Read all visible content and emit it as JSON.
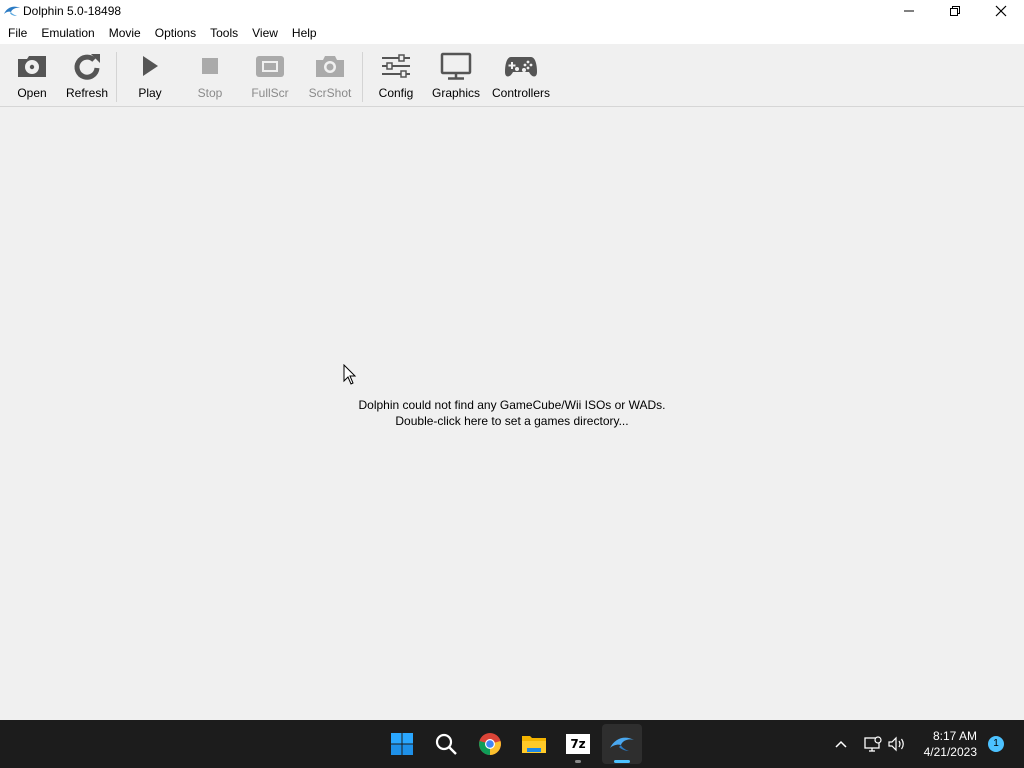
{
  "window": {
    "title": "Dolphin 5.0-18498",
    "icon": "dolphin-icon",
    "controls": [
      "minimize-icon",
      "restore-icon",
      "close-icon"
    ]
  },
  "menubar": {
    "items": [
      "File",
      "Emulation",
      "Movie",
      "Options",
      "Tools",
      "View",
      "Help"
    ]
  },
  "toolbar": {
    "buttons": [
      {
        "label": "Open",
        "icon": "open-disc-icon",
        "enabled": true
      },
      {
        "label": "Refresh",
        "icon": "refresh-icon",
        "enabled": true
      },
      {
        "label": "Play",
        "icon": "play-icon",
        "enabled": true
      },
      {
        "label": "Stop",
        "icon": "stop-icon",
        "enabled": false
      },
      {
        "label": "FullScr",
        "icon": "fullscreen-icon",
        "enabled": false
      },
      {
        "label": "ScrShot",
        "icon": "camera-icon",
        "enabled": false
      },
      {
        "label": "Config",
        "icon": "sliders-icon",
        "enabled": true
      },
      {
        "label": "Graphics",
        "icon": "monitor-icon",
        "enabled": true
      },
      {
        "label": "Controllers",
        "icon": "gamepad-icon",
        "enabled": true
      }
    ]
  },
  "main": {
    "empty_line1": "Dolphin could not find any GameCube/Wii ISOs or WADs.",
    "empty_line2": "Double-click here to set a games directory..."
  },
  "taskbar": {
    "apps": [
      "windows-start-icon",
      "search-icon",
      "chrome-icon",
      "file-explorer-icon",
      "7zip-icon",
      "dolphin-icon"
    ],
    "app_7zip_label": "7z",
    "active_app": "dolphin-icon",
    "time": "8:17 AM",
    "date": "4/21/2023",
    "notification_count": "1",
    "colors": {
      "accent": "#4cc2ff",
      "taskbar_bg": "#1c1c1c"
    }
  }
}
